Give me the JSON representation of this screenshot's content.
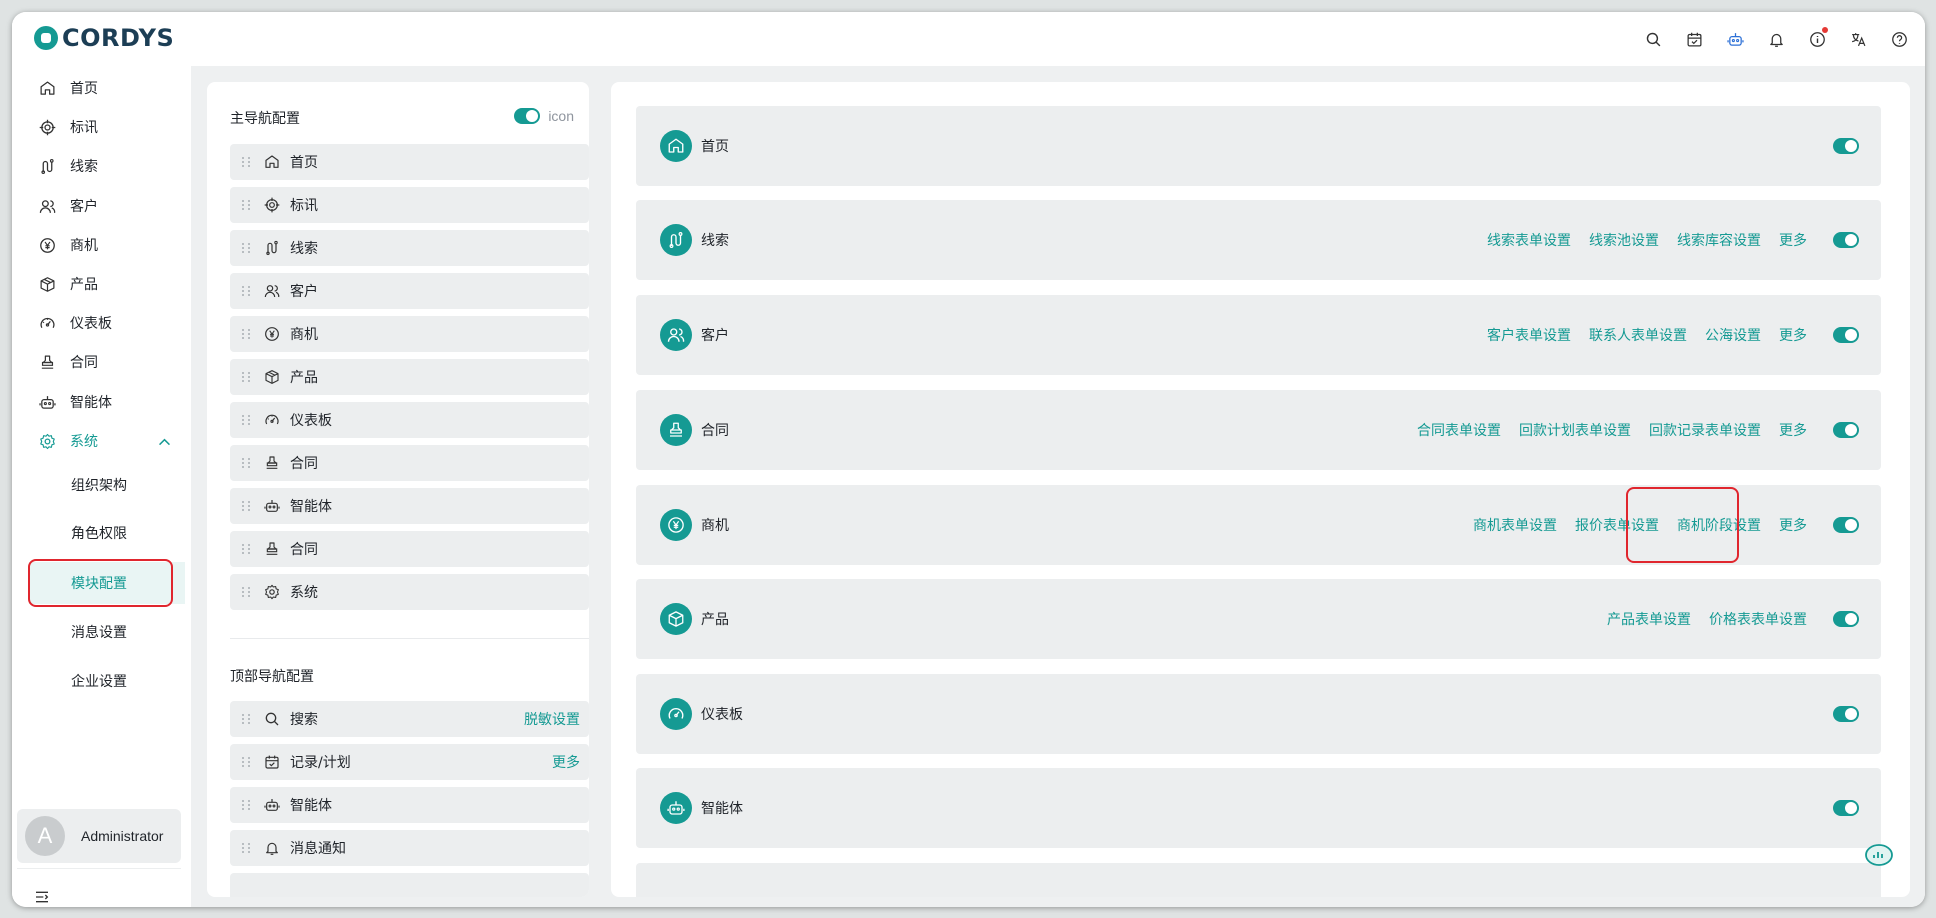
{
  "app": {
    "logo_text": "CORDYS"
  },
  "header_icons": [
    "search-icon",
    "calendar-check-icon",
    "robot-icon",
    "bell-icon",
    "info-icon",
    "translate-icon",
    "help-icon"
  ],
  "colors": {
    "accent": "#159a93",
    "highlight_border": "#e0262e",
    "notification_dot": "#e53935"
  },
  "sidebar": {
    "items": [
      {
        "label": "首页",
        "icon": "home-icon"
      },
      {
        "label": "标讯",
        "icon": "target-icon"
      },
      {
        "label": "线索",
        "icon": "route-icon"
      },
      {
        "label": "客户",
        "icon": "users-icon"
      },
      {
        "label": "商机",
        "icon": "yen-icon"
      },
      {
        "label": "产品",
        "icon": "box-icon"
      },
      {
        "label": "仪表板",
        "icon": "gauge-icon"
      },
      {
        "label": "合同",
        "icon": "stamp-icon"
      },
      {
        "label": "智能体",
        "icon": "robot-icon"
      },
      {
        "label": "系统",
        "icon": "gear-icon",
        "expanded": true
      }
    ],
    "sub_items": [
      {
        "label": "组织架构"
      },
      {
        "label": "角色权限"
      },
      {
        "label": "模块配置",
        "active": true
      },
      {
        "label": "消息设置"
      },
      {
        "label": "企业设置"
      }
    ],
    "user": {
      "avatar_letter": "A",
      "name": "Administrator"
    }
  },
  "left_panel": {
    "main_title": "主导航配置",
    "icon_toggle_label": "icon",
    "main_items": [
      {
        "label": "首页",
        "icon": "home-icon"
      },
      {
        "label": "标讯",
        "icon": "target-icon"
      },
      {
        "label": "线索",
        "icon": "route-icon"
      },
      {
        "label": "客户",
        "icon": "users-icon"
      },
      {
        "label": "商机",
        "icon": "yen-icon"
      },
      {
        "label": "产品",
        "icon": "box-icon"
      },
      {
        "label": "仪表板",
        "icon": "gauge-icon"
      },
      {
        "label": "合同",
        "icon": "stamp-icon"
      },
      {
        "label": "智能体",
        "icon": "robot-icon"
      },
      {
        "label": "合同",
        "icon": "stamp-icon"
      },
      {
        "label": "系统",
        "icon": "gear-icon"
      }
    ],
    "top_title": "顶部导航配置",
    "top_items": [
      {
        "label": "搜索",
        "icon": "search-icon",
        "link": "脱敏设置"
      },
      {
        "label": "记录/计划",
        "icon": "calendar-check-icon",
        "link": "更多"
      },
      {
        "label": "智能体",
        "icon": "robot-icon",
        "link": ""
      },
      {
        "label": "消息通知",
        "icon": "bell-icon",
        "link": ""
      }
    ]
  },
  "modules": [
    {
      "label": "首页",
      "icon": "home-icon",
      "links": [],
      "enabled": true
    },
    {
      "label": "线索",
      "icon": "route-icon",
      "links": [
        "线索表单设置",
        "线索池设置",
        "线索库容设置",
        "更多"
      ],
      "enabled": true
    },
    {
      "label": "客户",
      "icon": "users-icon",
      "links": [
        "客户表单设置",
        "联系人表单设置",
        "公海设置",
        "更多"
      ],
      "enabled": true
    },
    {
      "label": "合同",
      "icon": "stamp-icon",
      "links": [
        "合同表单设置",
        "回款计划表单设置",
        "回款记录表单设置",
        "更多"
      ],
      "enabled": true
    },
    {
      "label": "商机",
      "icon": "yen-icon",
      "links": [
        "商机表单设置",
        "报价表单设置",
        "商机阶段设置",
        "更多"
      ],
      "enabled": true,
      "highlighted_link": "商机阶段设置"
    },
    {
      "label": "产品",
      "icon": "box-icon",
      "links": [
        "产品表单设置",
        "价格表表单设置"
      ],
      "enabled": true
    },
    {
      "label": "仪表板",
      "icon": "gauge-icon",
      "links": [],
      "enabled": true
    },
    {
      "label": "智能体",
      "icon": "robot-icon",
      "links": [],
      "enabled": true
    }
  ]
}
